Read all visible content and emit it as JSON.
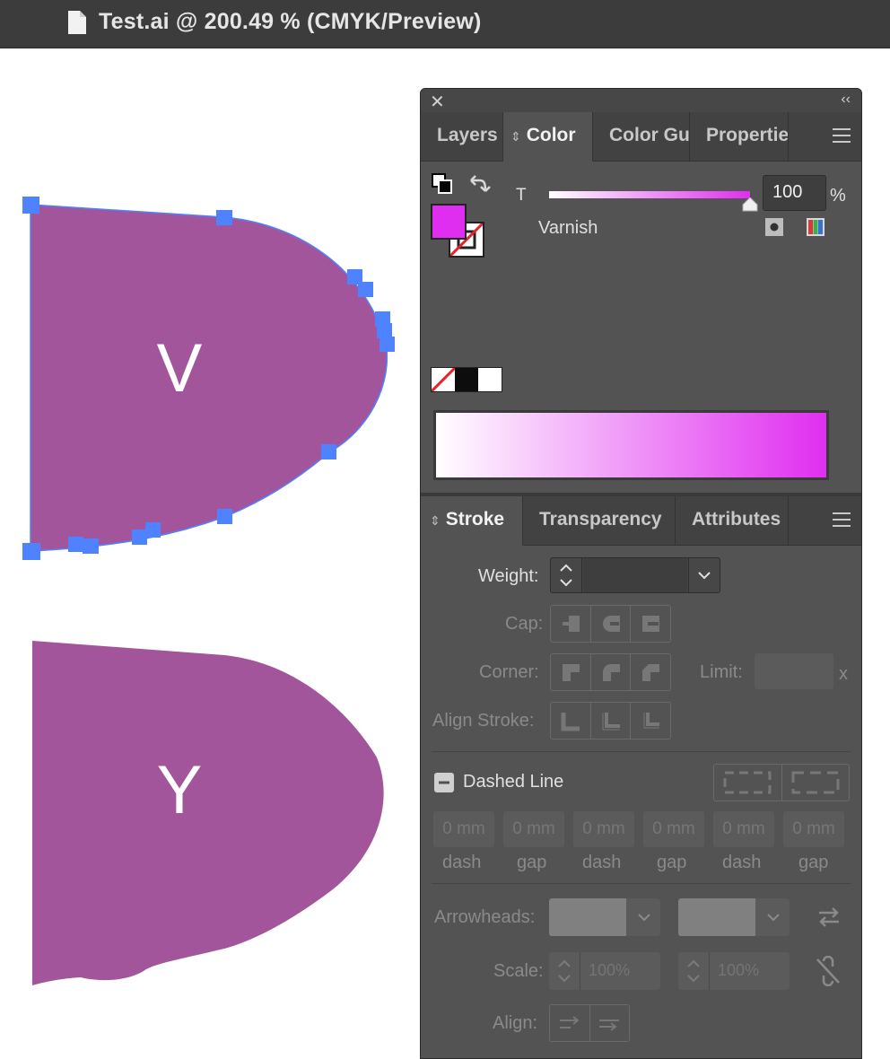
{
  "window": {
    "title": "Test.ai @ 200.49 % (CMYK/Preview)"
  },
  "canvas": {
    "shape_top_letter": "V",
    "shape_bottom_letter": "Y",
    "shape_fill": "#a2559a",
    "anchor_color": "#4f82ff"
  },
  "panel": {
    "close_glyph": "✕",
    "collapse_glyph": "‹‹",
    "top_tabs": [
      {
        "label": "Layers"
      },
      {
        "label": "Color"
      },
      {
        "label": "Color Gu"
      },
      {
        "label": "Propertie"
      }
    ],
    "color": {
      "channel_label": "T",
      "channel_value": "100",
      "percent_label": "%",
      "swatch_name": "Varnish",
      "fill_color": "#e02ef0",
      "slider_level": 1.0
    },
    "bottom_tabs": [
      {
        "label": "Stroke"
      },
      {
        "label": "Transparency"
      },
      {
        "label": "Attributes"
      }
    ],
    "stroke": {
      "weight_label": "Weight:",
      "weight_value": "",
      "cap_label": "Cap:",
      "corner_label": "Corner:",
      "limit_label": "Limit:",
      "limit_unit": "x",
      "align_label": "Align Stroke:",
      "dashed_label": "Dashed Line",
      "dash_fields": [
        {
          "value": "0 mm",
          "caption": "dash"
        },
        {
          "value": "0 mm",
          "caption": "gap"
        },
        {
          "value": "0 mm",
          "caption": "dash"
        },
        {
          "value": "0 mm",
          "caption": "gap"
        },
        {
          "value": "0 mm",
          "caption": "dash"
        },
        {
          "value": "0 mm",
          "caption": "gap"
        }
      ],
      "arrowheads_label": "Arrowheads:",
      "scale_label": "Scale:",
      "scale_start": "100%",
      "scale_end": "100%",
      "align_arrows_label": "Align:"
    }
  }
}
